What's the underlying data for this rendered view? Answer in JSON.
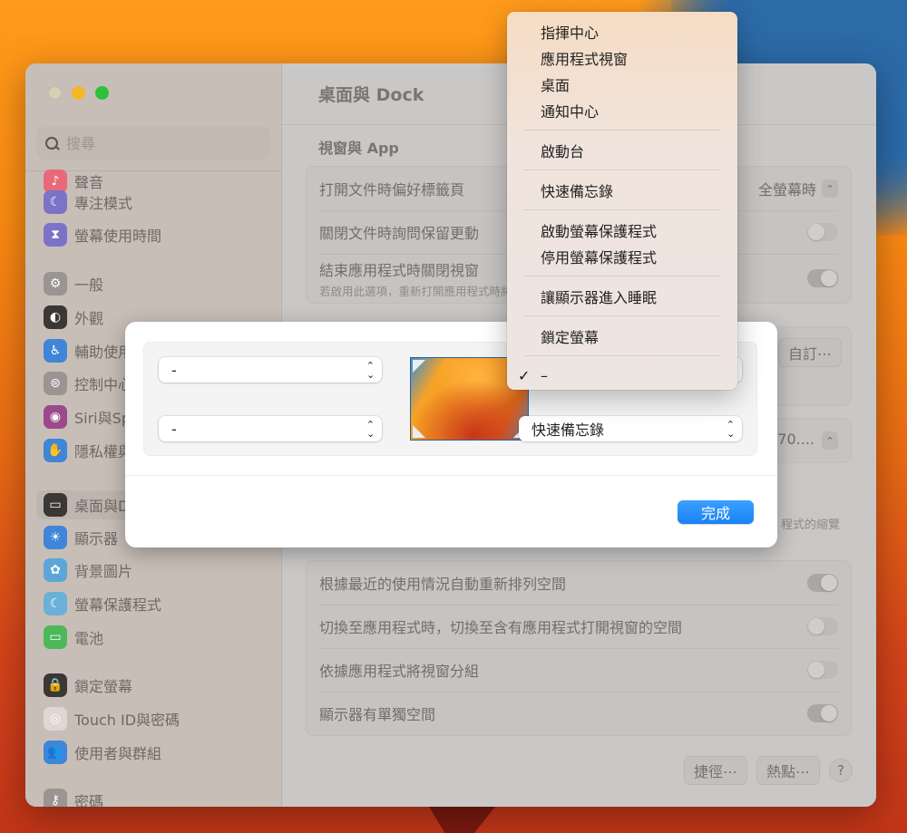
{
  "window": {
    "title": "桌面與 Dock"
  },
  "sidebar": {
    "search_placeholder": "搜尋",
    "items": [
      {
        "label": "聲音",
        "icon": "speaker-icon",
        "color": "#e86a7a"
      },
      {
        "label": "專注模式",
        "icon": "moon-icon",
        "color": "#7b73c8"
      },
      {
        "label": "螢幕使用時間",
        "icon": "hourglass-icon",
        "color": "#7b73c8"
      },
      {
        "label": "一般",
        "icon": "gear-icon",
        "color": "#9a9592"
      },
      {
        "label": "外觀",
        "icon": "appearance-icon",
        "color": "#3a3735"
      },
      {
        "label": "輔助使用",
        "icon": "accessibility-icon",
        "color": "#3f86d8"
      },
      {
        "label": "控制中心",
        "icon": "control-center-icon",
        "color": "#9a9592"
      },
      {
        "label": "Siri與Spotlight",
        "icon": "siri-icon",
        "color": "#9a4a8a"
      },
      {
        "label": "隱私權與安全性",
        "icon": "hand-icon",
        "color": "#3f86d8"
      },
      {
        "label": "桌面與Dock",
        "icon": "dock-icon",
        "color": "#3a3735",
        "active": true
      },
      {
        "label": "顯示器",
        "icon": "sun-icon",
        "color": "#3f86d8"
      },
      {
        "label": "背景圖片",
        "icon": "flower-icon",
        "color": "#5aa6d8"
      },
      {
        "label": "螢幕保護程式",
        "icon": "screensaver-icon",
        "color": "#6ab0d8"
      },
      {
        "label": "電池",
        "icon": "battery-icon",
        "color": "#4cb85a"
      },
      {
        "label": "鎖定螢幕",
        "icon": "lock-icon",
        "color": "#3a3735"
      },
      {
        "label": "Touch ID與密碼",
        "icon": "fingerprint-icon",
        "color": "#e0d6d2"
      },
      {
        "label": "使用者與群組",
        "icon": "users-icon",
        "color": "#3f86d8"
      },
      {
        "label": "密碼",
        "icon": "key-icon",
        "color": "#9a9592"
      }
    ]
  },
  "content": {
    "section_title": "視窗與 App",
    "group1": [
      {
        "label": "打開文件時偏好標籤頁",
        "value": "全螢幕時",
        "control": "popup"
      },
      {
        "label": "關閉文件時詢問保留更動",
        "control": "toggle",
        "on": false
      },
      {
        "label": "結束應用程式時關閉視窗",
        "sub": "若啟用此選項，重新打開應用程式時將不會回復已打開的文件和視窗。",
        "control": "toggle",
        "on": true
      }
    ],
    "custom_button": "自訂⋯",
    "partial_value": "70....",
    "partial_text": "程式的縮覽",
    "group2": [
      {
        "label": "根據最近的使用情況自動重新排列空間",
        "on": true
      },
      {
        "label": "切換至應用程式時，切換至含有應用程式打開視窗的空間",
        "on": false
      },
      {
        "label": "依據應用程式將視窗分組",
        "on": false
      },
      {
        "label": "顯示器有單獨空間",
        "on": true
      }
    ],
    "shortcuts_button": "捷徑⋯",
    "hot_corners_button": "熱點⋯",
    "help_button": "?"
  },
  "sheet": {
    "top_left": "-",
    "bottom_left": "-",
    "bottom_right": "快速備忘錄",
    "done_button": "完成"
  },
  "menu": {
    "items": [
      {
        "label": "指揮中心",
        "group": 0
      },
      {
        "label": "應用程式視窗",
        "group": 0
      },
      {
        "label": "桌面",
        "group": 0
      },
      {
        "label": "通知中心",
        "group": 0
      },
      {
        "label": "啟動台",
        "group": 1
      },
      {
        "label": "快速備忘錄",
        "group": 2
      },
      {
        "label": "啟動螢幕保護程式",
        "group": 3
      },
      {
        "label": "停用螢幕保護程式",
        "group": 3
      },
      {
        "label": "讓顯示器進入睡眠",
        "group": 4
      },
      {
        "label": "鎖定螢幕",
        "group": 5
      },
      {
        "label": "–",
        "group": 6,
        "checked": true
      }
    ]
  }
}
